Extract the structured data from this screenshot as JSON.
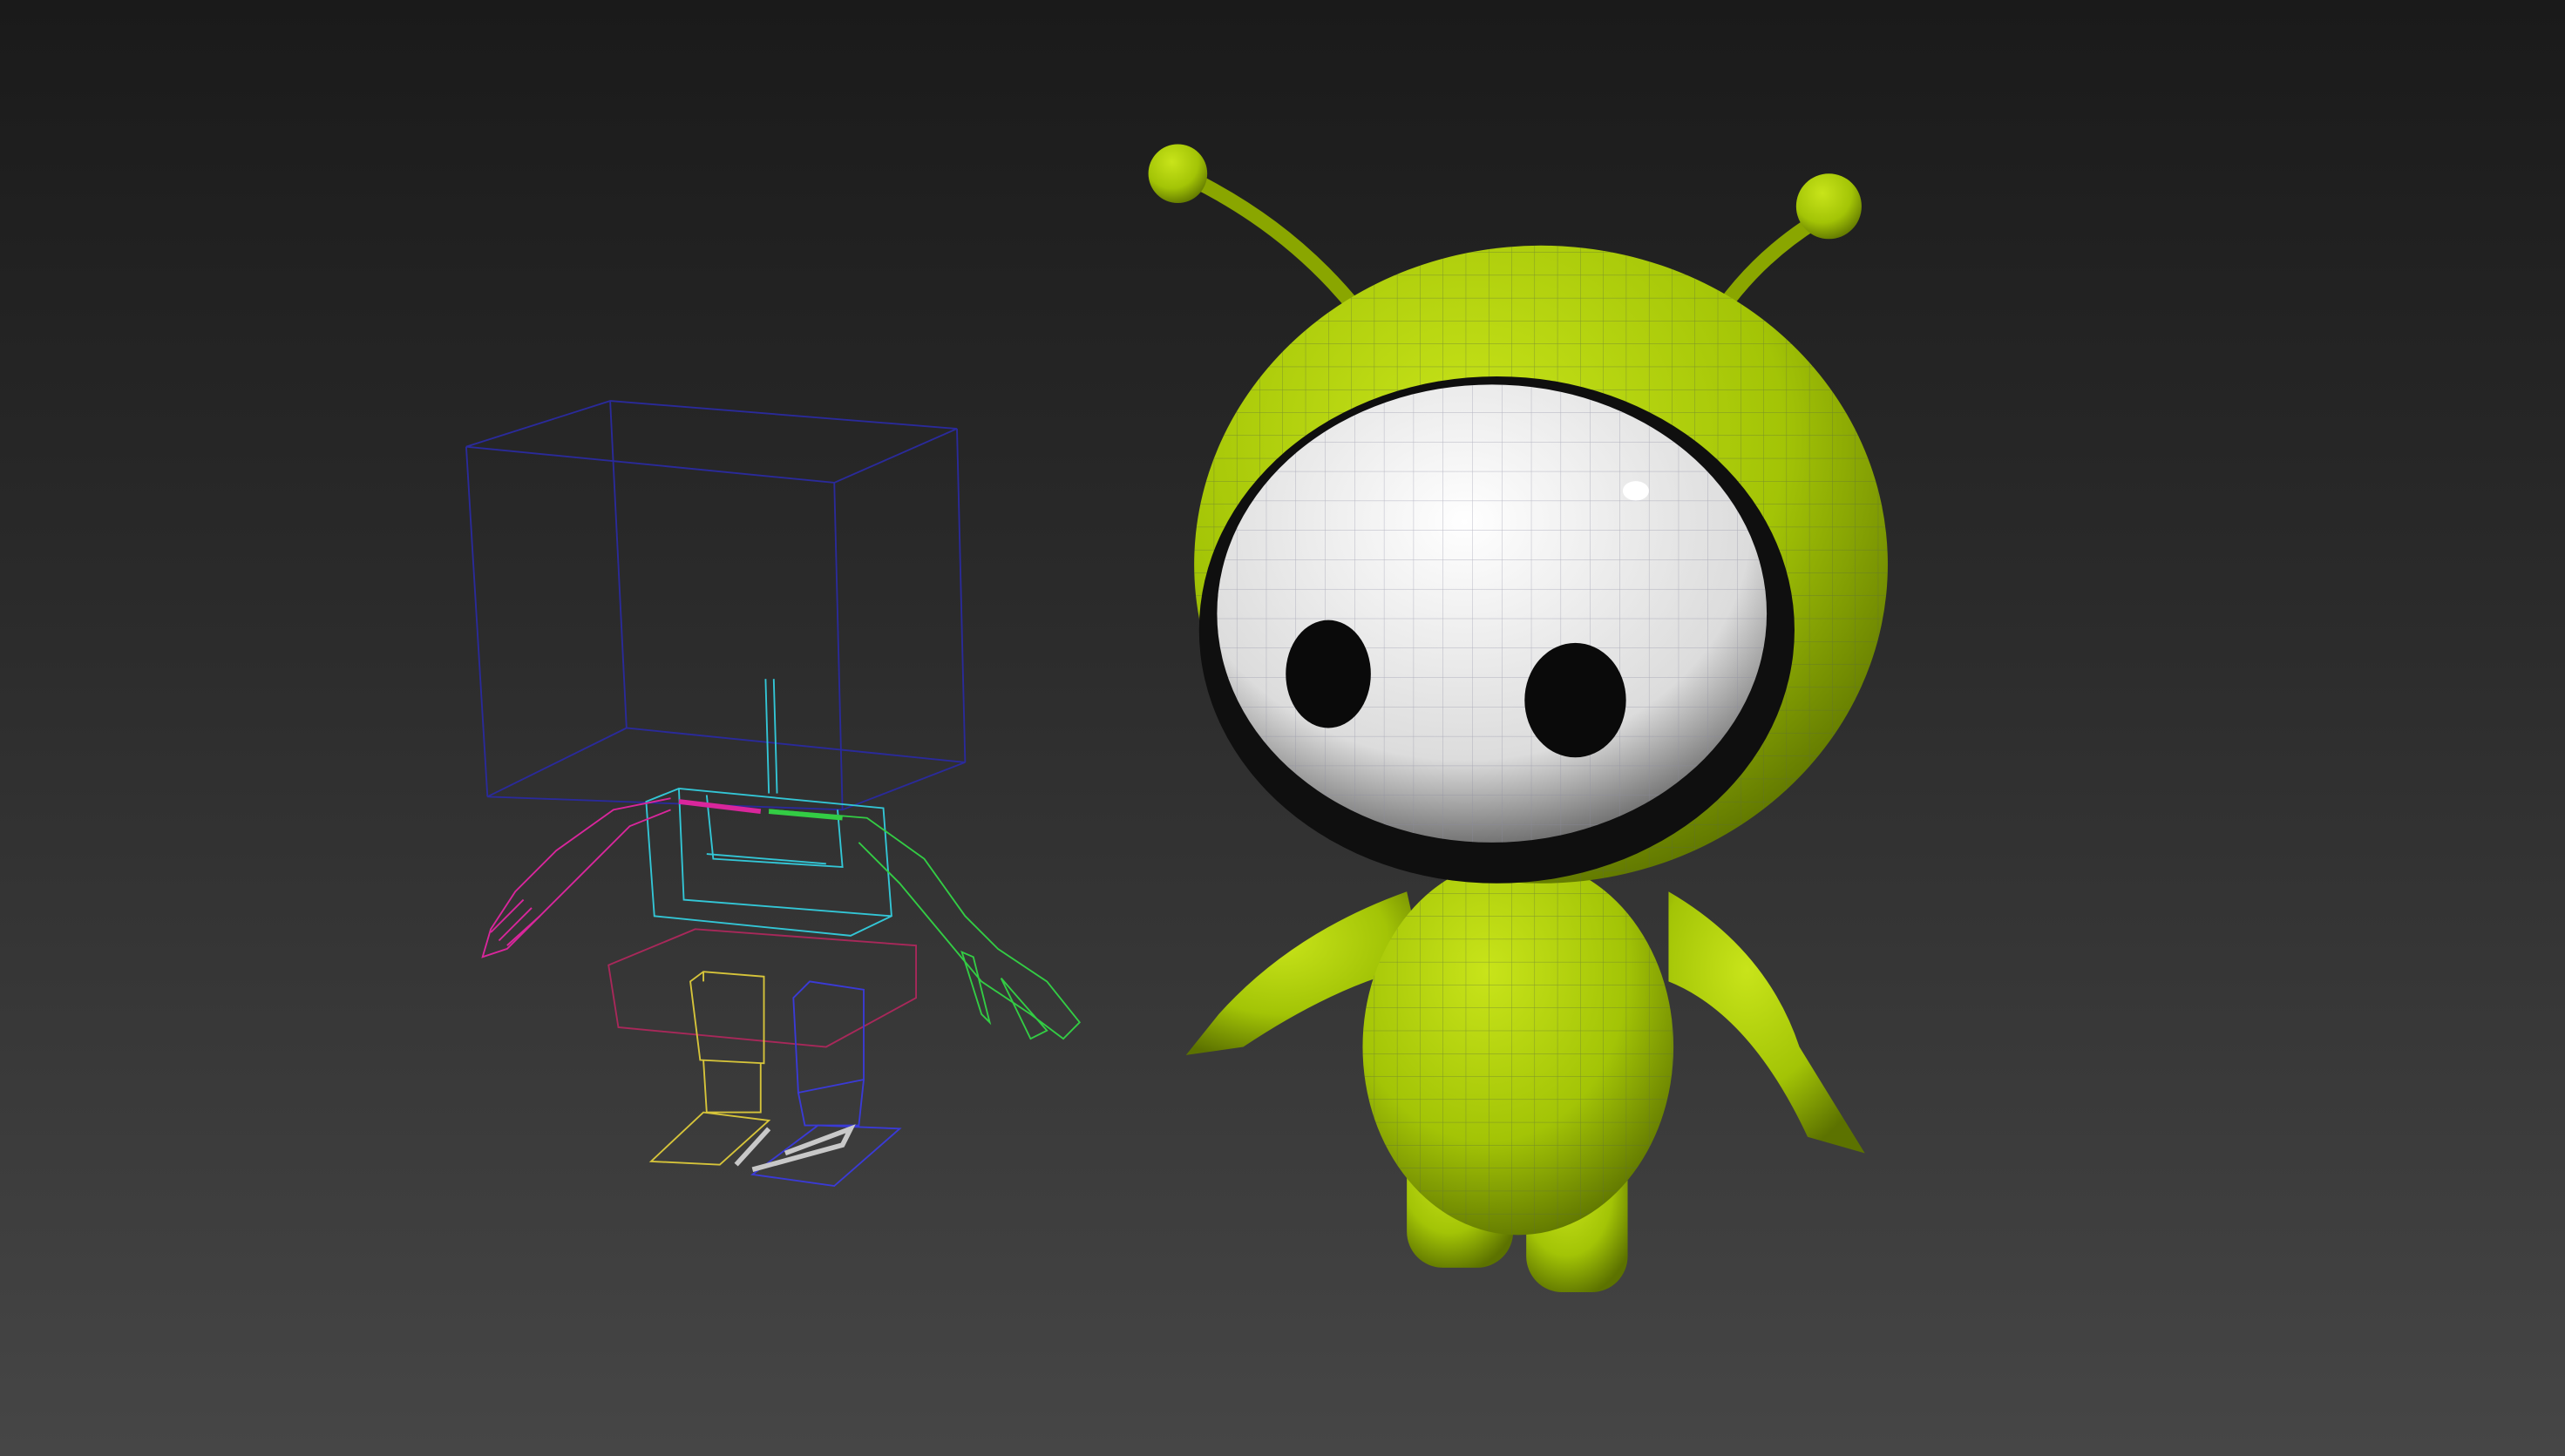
{
  "scene": {
    "colors": {
      "body": "#a8c80a",
      "body_dark": "#6f8a00",
      "visor": "#f2f2f2",
      "eye": "#0a0a0a",
      "rig_box": "#2a2a9a",
      "rig_cyan": "#33c6d6",
      "rig_magenta": "#d9269c",
      "rig_green": "#33cc44",
      "rig_yellow": "#d6c43a",
      "rig_blue": "#3a3ad6"
    }
  }
}
